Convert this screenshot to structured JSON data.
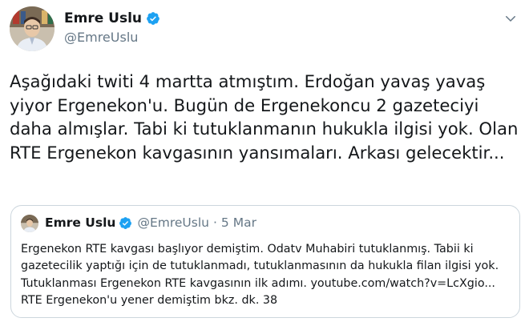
{
  "author": {
    "display_name": "Emre Uslu",
    "handle": "@EmreUslu",
    "avatar_icon": "user-avatar",
    "verified_icon": "verified-badge-icon"
  },
  "tweet": {
    "text": "Aşağıdaki twiti 4 martta atmıştım. Erdoğan yavaş yavaş yiyor Ergenekon'u. Bugün de Ergenekoncu 2 gazeteciyi daha almışlar. Tabi ki tutuklanmanın hukukla ilgisi yok. Olan RTE Ergenekon kavgasının yansımaları. Arkası gelecektir..."
  },
  "quoted_tweet": {
    "display_name": "Emre Uslu",
    "handle": "@EmreUslu",
    "separator": "·",
    "date": "5 Mar",
    "lines": [
      "Ergenekon RTE kavgası başlıyor demiştim. Odatv Muhabiri tutuklanmış. Tabii ki",
      "gazetecilik yaptığı için de tutuklanmadı, tutuklanmasının da hukukla filan ilgisi yok.",
      "Tutuklanması Ergenekon RTE kavgasının ilk adımı. youtube.com/watch?v=LcXgio...",
      "RTE Ergenekon'u yener demiştim bkz. dk. 38"
    ]
  },
  "colors": {
    "verified_blue": "#1da1f2",
    "text_primary": "#14171a",
    "text_secondary": "#657786",
    "border": "#ccd6dd"
  }
}
